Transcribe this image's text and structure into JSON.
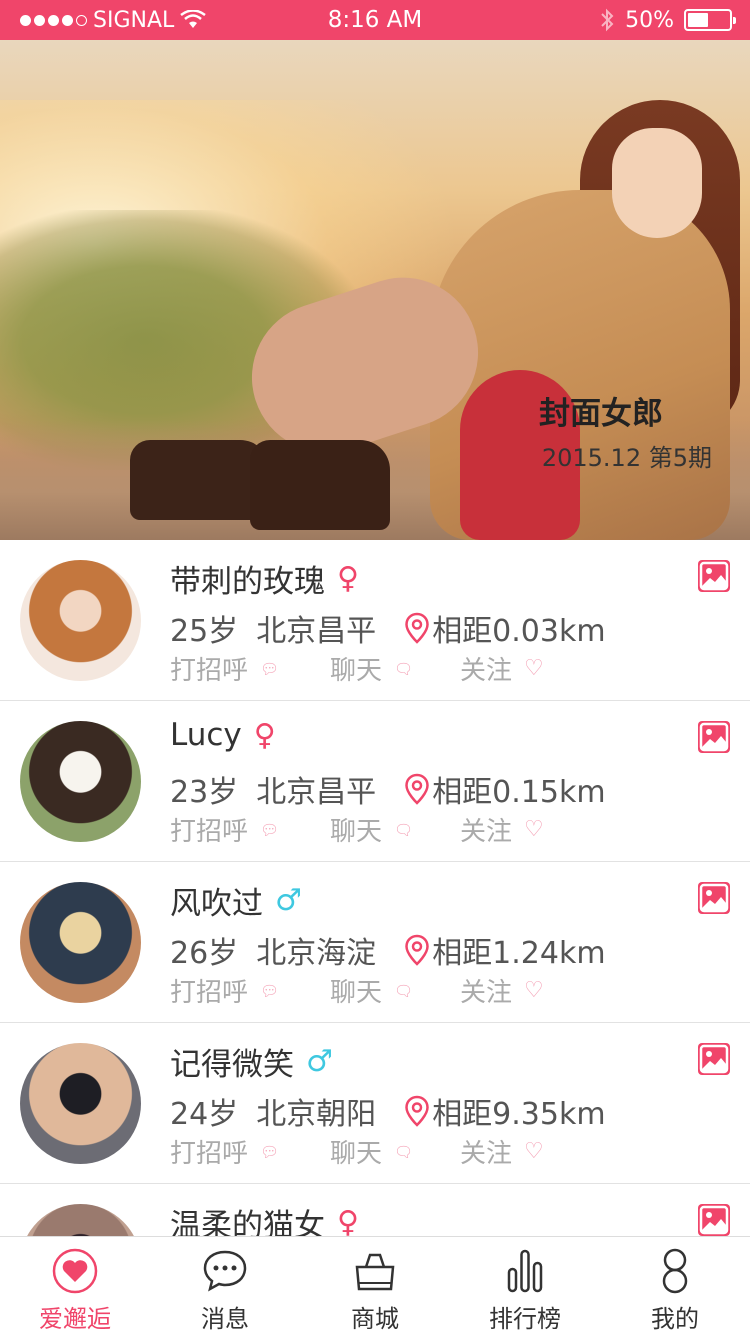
{
  "status_bar": {
    "carrier": "SIGNAL",
    "time": "8:16 AM",
    "battery": "50%",
    "battery_level": 0.5
  },
  "hero": {
    "title": "封面女郎",
    "subtitle": "2015.12 第5期"
  },
  "users": [
    {
      "name": "带刺的玫瑰",
      "gender": "female",
      "gender_icon": "♀",
      "age": "25岁",
      "location": "北京昌平",
      "distance": "相距0.03km",
      "avatar_colors": [
        "#f2d6c2",
        "#c4773e",
        "#f4e7de"
      ]
    },
    {
      "name": "Lucy",
      "gender": "female",
      "gender_icon": "♀",
      "age": "23岁",
      "location": "北京昌平",
      "distance": "相距0.15km",
      "avatar_colors": [
        "#f7f4ee",
        "#3a2a22",
        "#8ca26a"
      ]
    },
    {
      "name": "风吹过",
      "gender": "male",
      "gender_icon": "♂",
      "age": "26岁",
      "location": "北京海淀",
      "distance": "相距1.24km",
      "avatar_colors": [
        "#ead3a0",
        "#2e3c4e",
        "#c48a62"
      ]
    },
    {
      "name": "记得微笑",
      "gender": "male",
      "gender_icon": "♂",
      "age": "24岁",
      "location": "北京朝阳",
      "distance": "相距9.35km",
      "avatar_colors": [
        "#1e1e24",
        "#e0b89a",
        "#6c6c74"
      ]
    },
    {
      "name": "温柔的猫女",
      "gender": "female",
      "gender_icon": "♀",
      "age": "",
      "location": "",
      "distance": "",
      "avatar_colors": [
        "#2c2028",
        "#9a7a6e",
        "#c0a090"
      ]
    }
  ],
  "actions": {
    "greet": "打招呼",
    "chat": "聊天",
    "follow": "关注"
  },
  "tabs": [
    {
      "label": "爱邂逅",
      "icon": "heart-icon",
      "active": true
    },
    {
      "label": "消息",
      "icon": "chat-bubble-icon",
      "active": false
    },
    {
      "label": "商城",
      "icon": "shopping-bag-icon",
      "active": false
    },
    {
      "label": "排行榜",
      "icon": "bar-chart-icon",
      "active": false
    },
    {
      "label": "我的",
      "icon": "person-icon",
      "active": false
    }
  ],
  "colors": {
    "accent": "#f0456a",
    "male": "#3fc8e0",
    "muted": "#aaaaaa"
  }
}
